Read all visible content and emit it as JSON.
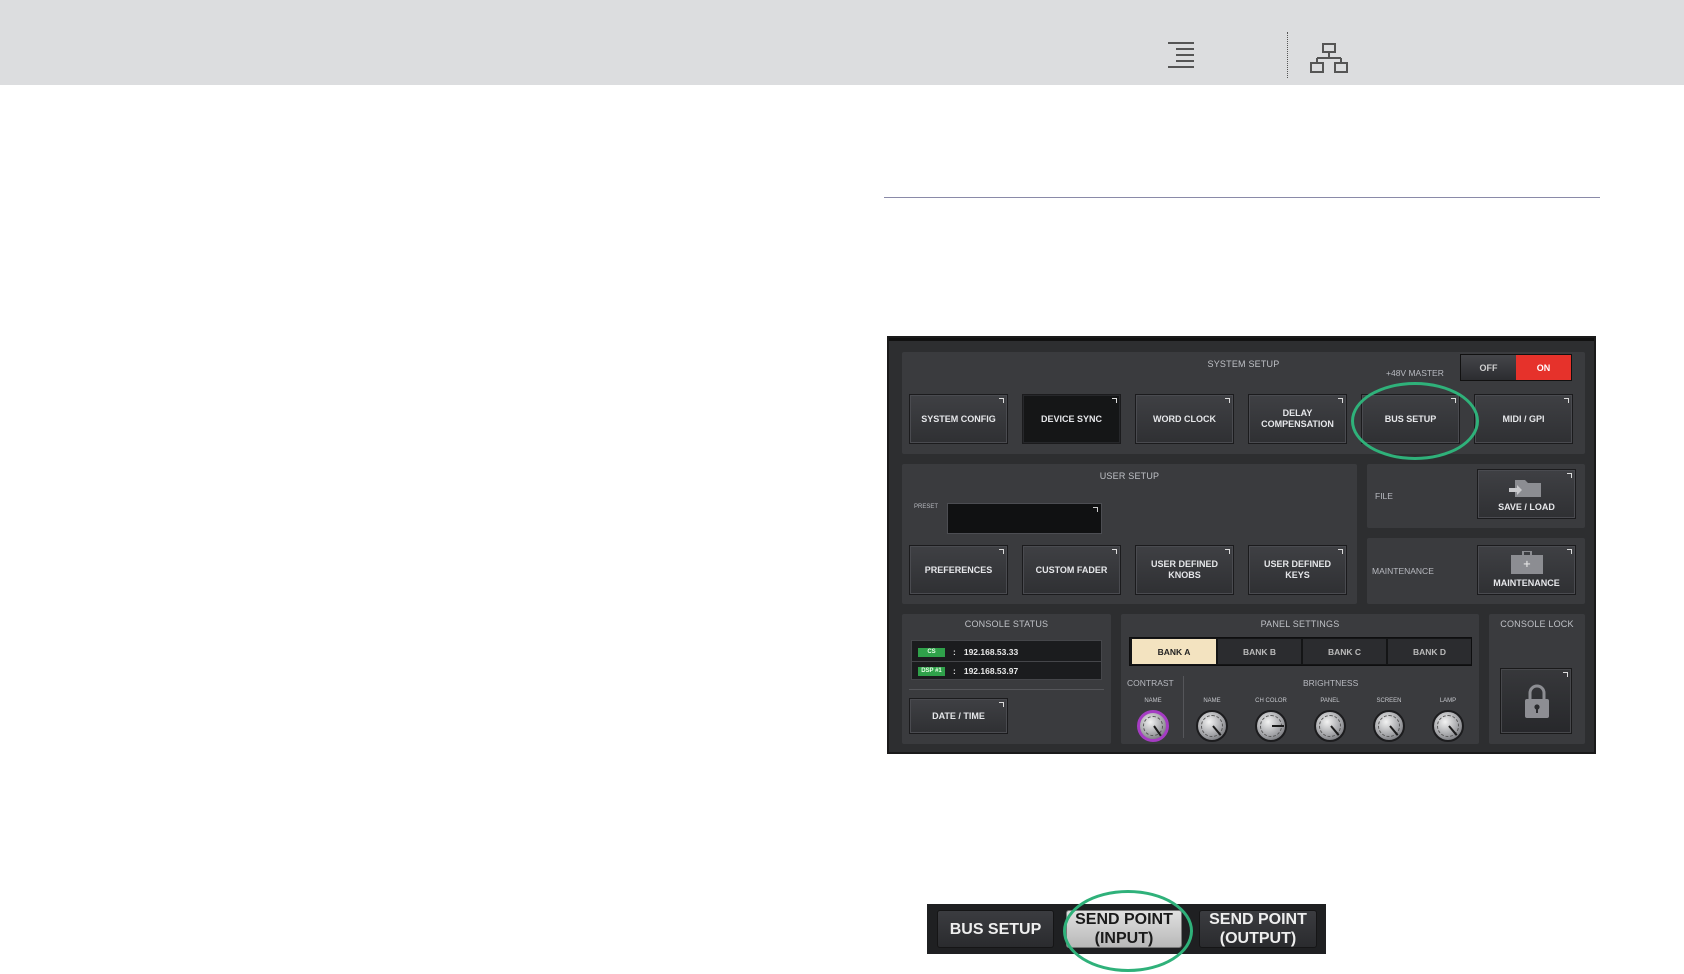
{
  "toolbar": {
    "toc_icon": "toc-indent-icon",
    "sitemap_icon": "sitemap-icon"
  },
  "console": {
    "system_setup": {
      "title": "SYSTEM SETUP",
      "phantom_label": "+48V MASTER",
      "phantom_off": "OFF",
      "phantom_on": "ON",
      "phantom_state": "ON",
      "buttons": [
        "SYSTEM CONFIG",
        "DEVICE SYNC",
        "WORD CLOCK",
        "DELAY\nCOMPENSATION",
        "BUS SETUP",
        "MIDI / GPI"
      ]
    },
    "user_setup": {
      "title": "USER SETUP",
      "preset_label": "PRESET",
      "buttons": [
        "PREFERENCES",
        "CUSTOM FADER",
        "USER DEFINED\nKNOBS",
        "USER DEFINED\nKEYS"
      ]
    },
    "file": {
      "label": "FILE",
      "button": "SAVE / LOAD"
    },
    "maintenance": {
      "label": "MAINTENANCE",
      "button": "MAINTENANCE"
    },
    "console_status": {
      "title": "CONSOLE STATUS",
      "rows": [
        {
          "tag": "CS",
          "sep": ":",
          "ip": "192.168.53.33"
        },
        {
          "tag": "DSP #1",
          "sep": ":",
          "ip": "192.168.53.97"
        }
      ],
      "date_button": "DATE / TIME"
    },
    "panel_settings": {
      "title": "PANEL SETTINGS",
      "banks": [
        "BANK A",
        "BANK B",
        "BANK C",
        "BANK D"
      ],
      "active_bank": "BANK A",
      "contrast_label": "CONTRAST",
      "brightness_label": "BRIGHTNESS",
      "knobs": [
        {
          "label": "NAME",
          "group": "contrast"
        },
        {
          "label": "NAME",
          "group": "brightness"
        },
        {
          "label": "CH COLOR",
          "group": "brightness"
        },
        {
          "label": "PANEL",
          "group": "brightness"
        },
        {
          "label": "SCREEN",
          "group": "brightness"
        },
        {
          "label": "LAMP",
          "group": "brightness"
        }
      ]
    },
    "console_lock": {
      "title": "CONSOLE LOCK",
      "icon": "lock-icon"
    }
  },
  "tabs": {
    "bus_setup": "BUS SETUP",
    "send_point_input": "SEND POINT\n(INPUT)",
    "send_point_output": "SEND POINT\n(OUTPUT)",
    "active": "send_point_input"
  },
  "colors": {
    "ring": "#2fb17a",
    "on": "#e6322b",
    "active_bank": "#f3e3c0"
  }
}
